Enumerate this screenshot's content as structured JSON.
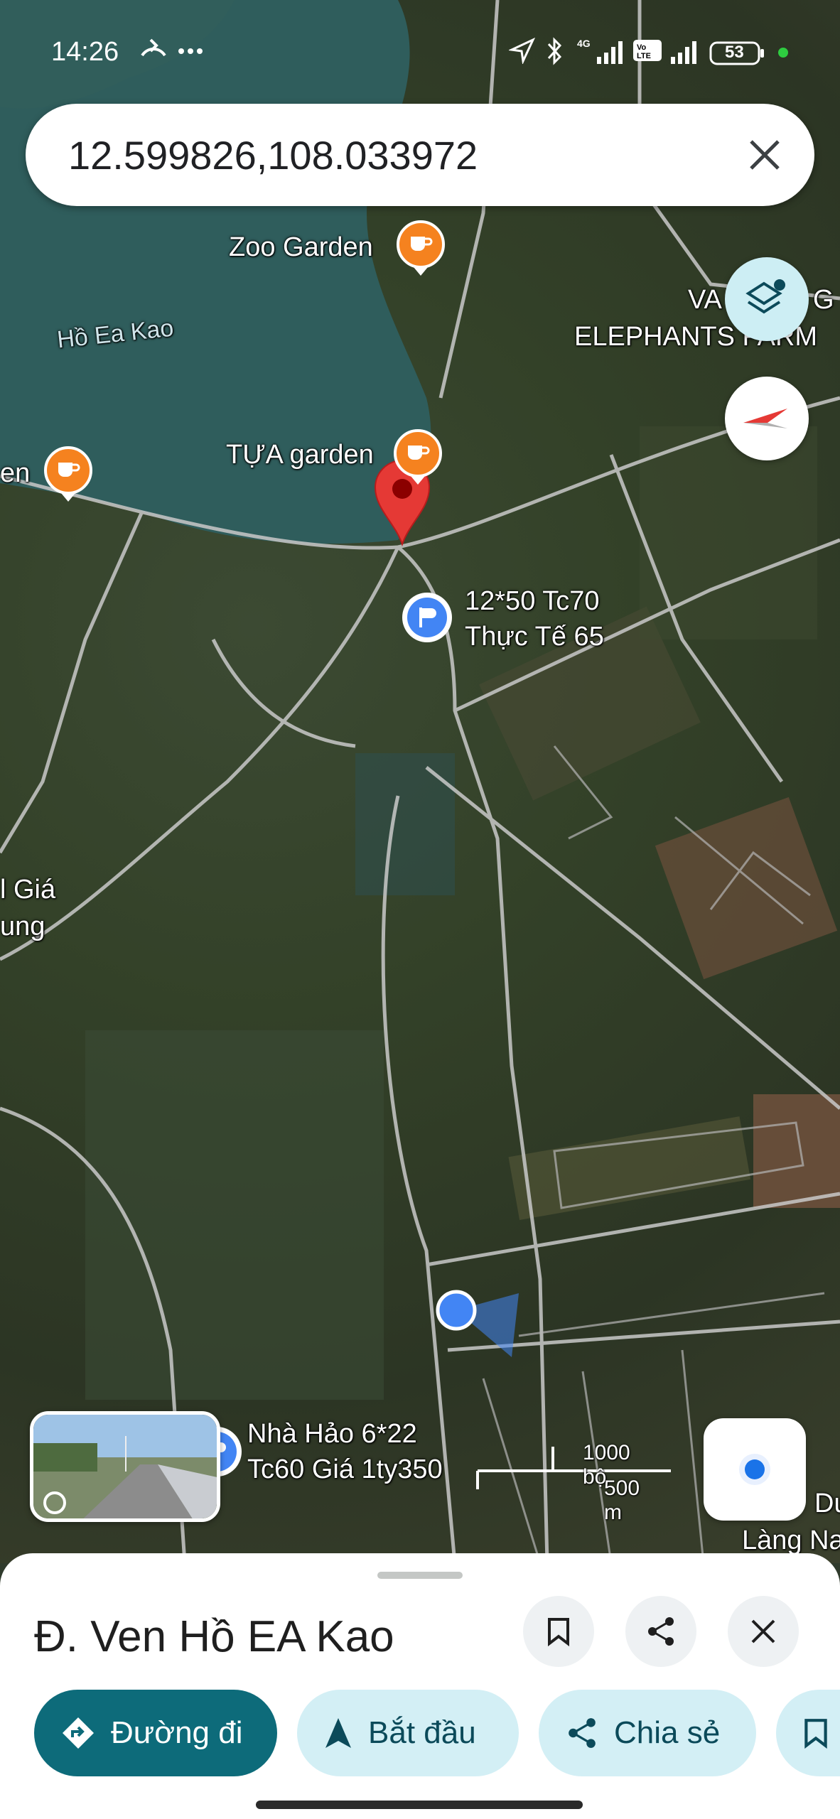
{
  "status_bar": {
    "time": "14:26",
    "icons": [
      "call-forward-icon",
      "more-dots-icon",
      "location-arrow-icon",
      "bluetooth-icon",
      "signal-4g-icon",
      "volte-icon",
      "signal-icon",
      "battery-icon"
    ],
    "battery_level": "53"
  },
  "search": {
    "value": "12.599826,108.033972",
    "clear_icon": "close-icon"
  },
  "map": {
    "labels": {
      "zoo_garden": "Zoo Garden",
      "lake": "Hồ Ea Kao",
      "elephants_farm_line1": "VA",
      "elephants_farm_line1b": "G",
      "elephants_farm_line2": "ELEPHANTS FARM",
      "tua_garden": "TỰA garden",
      "edge_left_en": "en",
      "pin_note_line1": "12*50 Tc70",
      "pin_note_line2": "Thực Tế 65",
      "edge_left_gia": "l Giá",
      "edge_left_ung": "ung",
      "nha_hao_line1": "Nhà Hảo 6*22",
      "nha_hao_line2": "Tc60 Giá 1ty350",
      "edge_right_d": "Dư",
      "edge_right_lang": "Làng Na"
    },
    "scale": {
      "imperial": "1000 bộ",
      "metric": "500 m"
    },
    "buttons": {
      "layers_icon": "layers-icon",
      "compass_icon": "compass-icon",
      "my_location_icon": "my-location-icon"
    },
    "colors": {
      "pin_red": "#e53935",
      "cafe_orange": "#f5821f",
      "location_blue": "#4285f4"
    }
  },
  "sheet": {
    "title": "Đ. Ven Hồ EA Kao",
    "actions": {
      "save_icon": "bookmark-icon",
      "share_icon": "share-icon",
      "close_icon": "close-icon"
    },
    "chips": [
      {
        "label": "Đường đi",
        "icon": "directions-icon"
      },
      {
        "label": "Bắt đầu",
        "icon": "navigation-arrow-icon"
      },
      {
        "label": "Chia sẻ",
        "icon": "share-icon"
      },
      {
        "label": "",
        "icon": "bookmark-icon"
      }
    ],
    "colors": {
      "primary_chip": "#0d6b7a",
      "secondary_chip": "#d3eff5"
    }
  }
}
